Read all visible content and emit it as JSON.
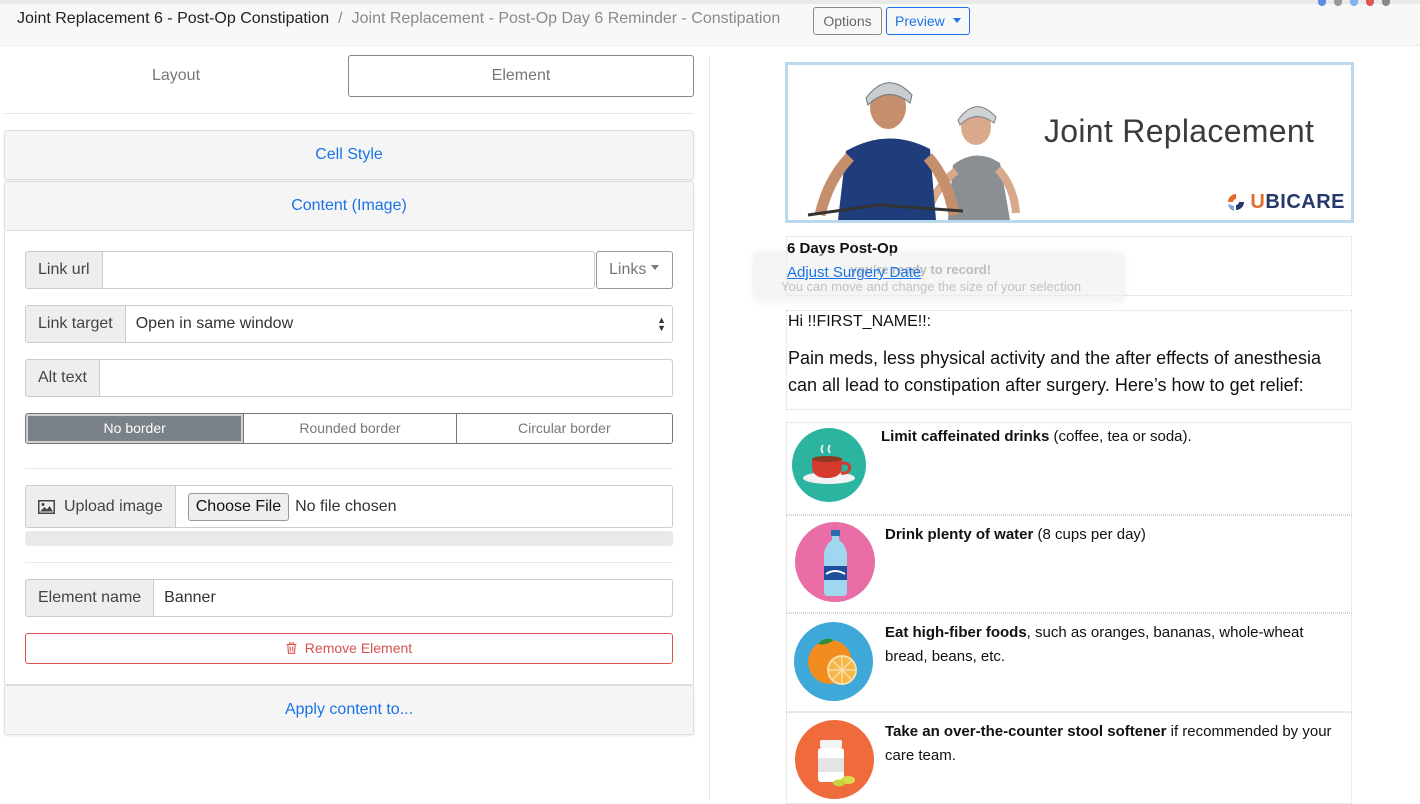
{
  "breadcrumb": {
    "item_1": "Joint Replacement 6 - Post-Op Constipation",
    "separator": "/",
    "item_2": "Joint Replacement - Post-Op Day 6 Reminder - Constipation"
  },
  "toolbar": {
    "options_label": "Options",
    "preview_label": "Preview"
  },
  "tabs": {
    "layout": "Layout",
    "element": "Element"
  },
  "panels": {
    "cell_style": "Cell Style",
    "content_image": "Content (Image)",
    "apply_content": "Apply content to..."
  },
  "form": {
    "link_url_label": "Link url",
    "link_url_value": "",
    "links_button": "Links",
    "link_target_label": "Link target",
    "link_target_value": "Open in same window",
    "alt_text_label": "Alt text",
    "alt_text_value": "",
    "border_options": [
      "No border",
      "Rounded border",
      "Circular border"
    ],
    "border_selected": "No border",
    "upload_label": "Upload image",
    "choose_file": "Choose File",
    "no_file": "No file chosen",
    "upload_progress": 0,
    "element_name_label": "Element name",
    "element_name_value": "Banner",
    "remove_button": "Remove Element"
  },
  "preview": {
    "banner_title": "Joint Replacement",
    "logo_text_1": "U",
    "logo_text_2": "BI",
    "logo_text_3": "C",
    "logo_text_4": "ARE",
    "postop_title": "6 Days Post-Op",
    "adjust_link": "Adjust Surgery Date",
    "toast_title": "you're ready to record!",
    "toast_body": "You can move and change the size of your selection",
    "greeting": "Hi !!FIRST_NAME!!:",
    "intro": "Pain meds, less physical activity and the after effects of anesthesia can all lead to constipation after surgery. Here’s how to get relief:",
    "tips": [
      {
        "bold": "Limit caffeinated drinks",
        "rest": " (coffee, tea or soda).",
        "icon": "coffee-cup-icon"
      },
      {
        "bold": "Drink plenty of water",
        "rest": " (8 cups per day)",
        "icon": "water-bottle-icon"
      },
      {
        "bold": "Eat high-fiber foods",
        "rest": ", such as oranges, bananas, whole-wheat bread, beans, etc.",
        "icon": "orange-icon"
      },
      {
        "bold": "Take an over-the-counter stool softener",
        "rest": " if recommended by your care team.",
        "icon": "pill-bottle-icon"
      }
    ]
  },
  "colors": {
    "accent": "#1a73e8",
    "danger": "#d9534f",
    "active_segment": "#7b8188",
    "banner_border": "#bcd8ec"
  }
}
